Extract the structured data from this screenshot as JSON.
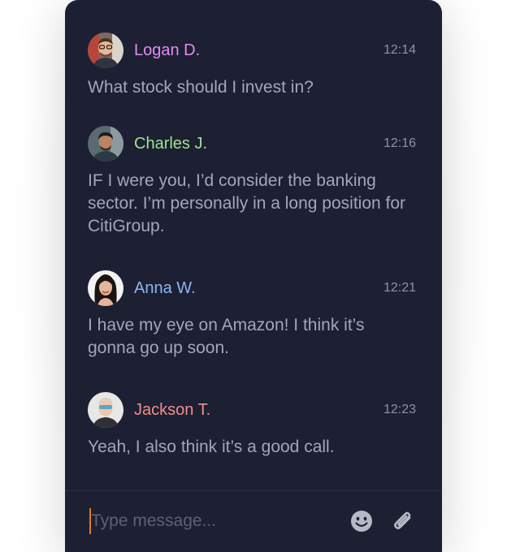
{
  "colors": {
    "panel_bg": "#1c2032",
    "message_text": "#a2a6b8",
    "time_text": "#8f93a6",
    "caret": "#e07a2e"
  },
  "messages": [
    {
      "author": "Logan D.",
      "author_color": "#e48cf0",
      "time": "12:14",
      "text": "What stock should I invest in?",
      "avatar_icon": "avatar-logan-icon"
    },
    {
      "author": "Charles J.",
      "author_color": "#9fe48f",
      "time": "12:16",
      "text": "IF I were you, I’d consider the banking sector. I’m personally in a long position for CitiGroup.",
      "avatar_icon": "avatar-charles-icon"
    },
    {
      "author": "Anna W.",
      "author_color": "#8fb6f0",
      "time": "12:21",
      "text": "I have my eye on Amazon! I think it’s gonna go up soon.",
      "avatar_icon": "avatar-anna-icon"
    },
    {
      "author": "Jackson T.",
      "author_color": "#f28d8d",
      "time": "12:23",
      "text": "Yeah, I also think it’s a good call.",
      "avatar_icon": "avatar-jackson-icon"
    }
  ],
  "composer": {
    "placeholder": "Type message...",
    "value": "",
    "emoji_icon": "smiley-icon",
    "attach_icon": "paperclip-icon"
  }
}
